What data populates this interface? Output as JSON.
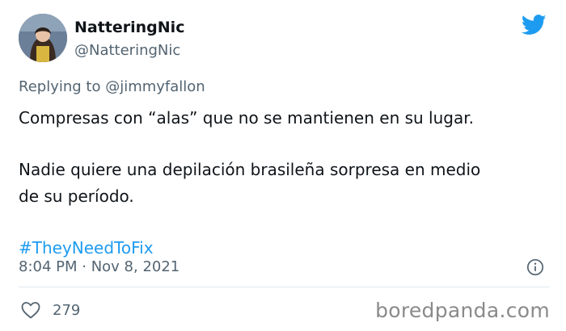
{
  "user": {
    "display_name": "NatteringNic",
    "handle": "@NatteringNic"
  },
  "reply": {
    "prefix": "Replying to ",
    "mention": "@jimmyfallon"
  },
  "tweet": {
    "line1": "Compresas con “alas” que no se mantienen en su lugar.",
    "line2": "Nadie quiere una depilación brasileña sorpresa en medio",
    "line3": "de su período.",
    "hashtag": "#TheyNeedToFix"
  },
  "meta": {
    "timestamp": "8:04 PM · Nov 8, 2021"
  },
  "stats": {
    "likes": "279"
  },
  "watermark": "boredpanda.com",
  "colors": {
    "link": "#1d9bf0",
    "secondary_text": "#536471",
    "twitter_blue": "#1d9bf0"
  },
  "icons": [
    "twitter-bird-icon",
    "info-icon",
    "heart-icon"
  ]
}
